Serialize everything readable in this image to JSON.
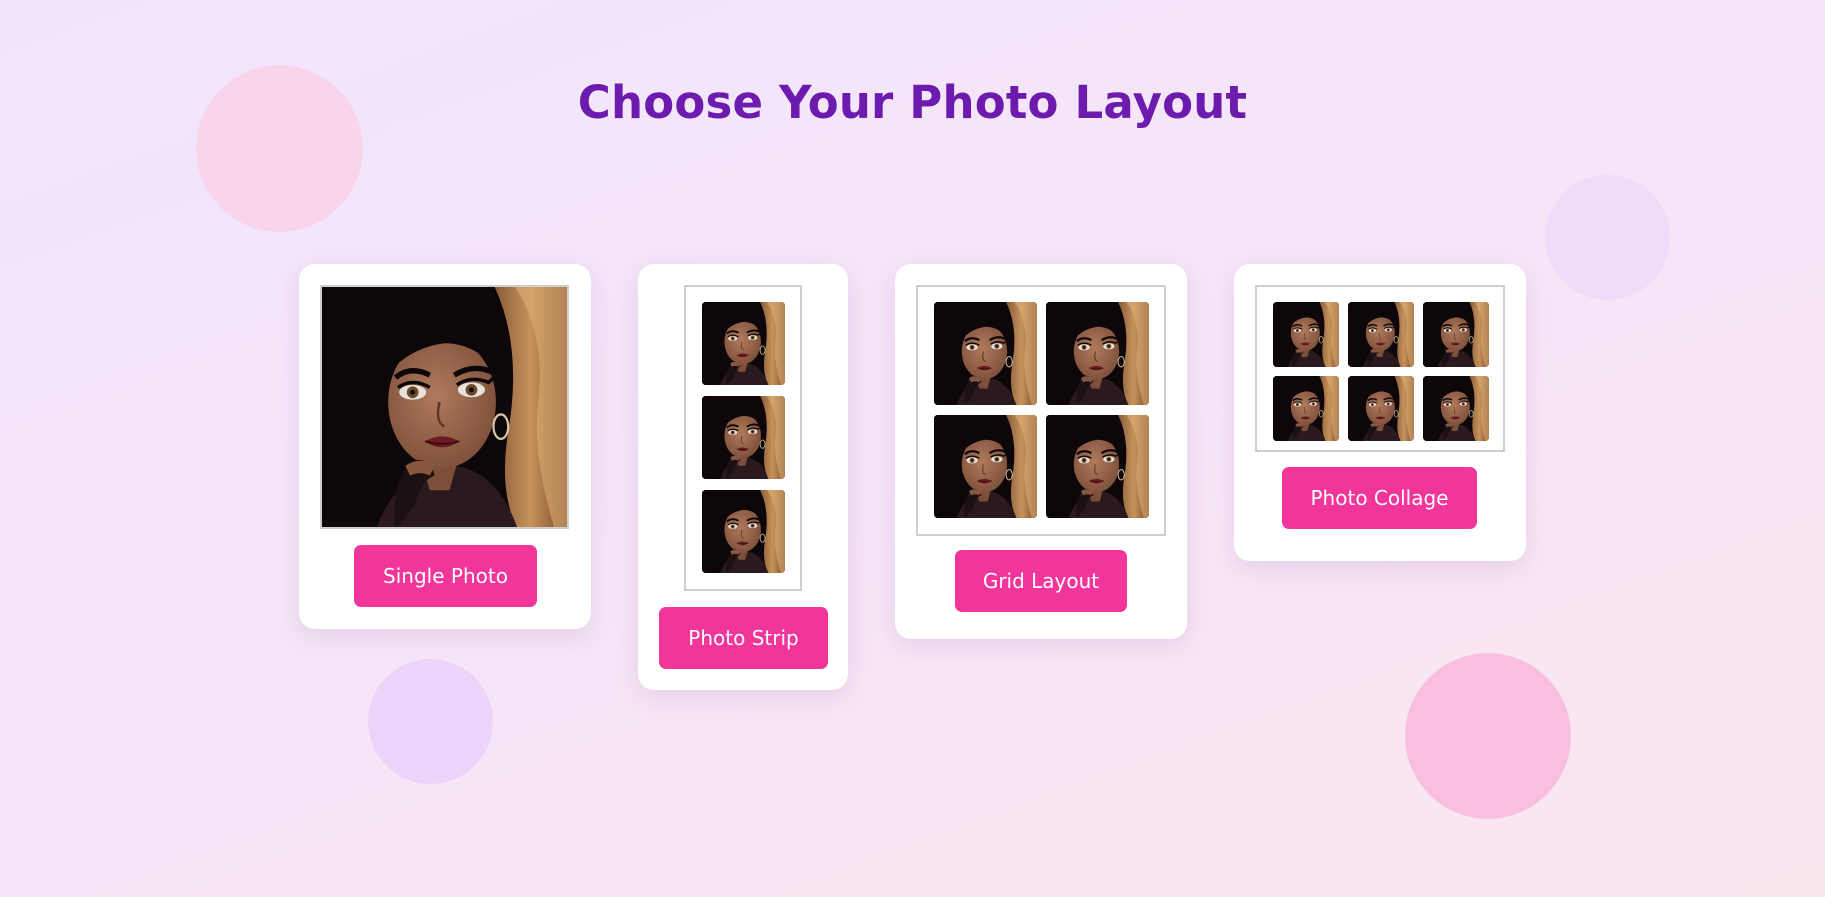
{
  "page": {
    "title": "Choose Your Photo Layout"
  },
  "layouts": [
    {
      "id": "single",
      "button_label": "Single Photo",
      "photo_count": 1
    },
    {
      "id": "strip",
      "button_label": "Photo Strip",
      "photo_count": 3
    },
    {
      "id": "grid",
      "button_label": "Grid Layout",
      "photo_count": 4
    },
    {
      "id": "collage",
      "button_label": "Photo Collage",
      "photo_count": 6
    }
  ],
  "colors": {
    "title": "#6d1aae",
    "button": "#f2359a",
    "button_text": "#ffffff",
    "card": "#ffffff",
    "frame_border": "#cfcfcf"
  },
  "icons": [
    "portrait-illustration"
  ]
}
